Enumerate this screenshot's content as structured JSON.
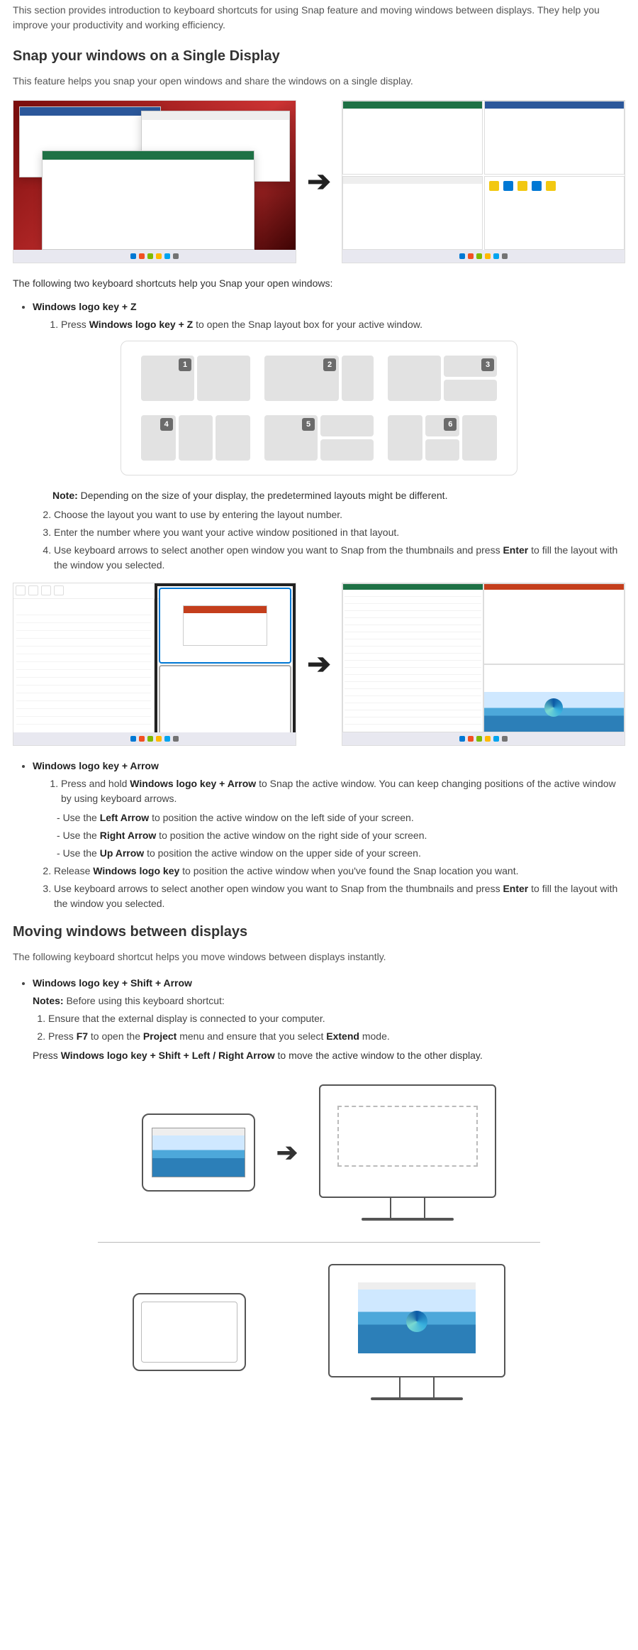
{
  "intro": {
    "p1": "This section provides introduction to keyboard shortcuts for using Snap feature and moving windows between displays. They help you improve your productivity and working efficiency."
  },
  "section1": {
    "heading": "Snap your windows on a Single Display",
    "desc": "This feature helps you snap your open windows and share the windows on a single display.",
    "para_following": "The following two keyboard shortcuts help you Snap your open windows:",
    "shortcut_z_label": "Windows logo key + Z",
    "z_step1_a": "Press ",
    "z_step1_b": "Windows logo key + Z",
    "z_step1_c": " to open the Snap layout box for your active window.",
    "note_label": "Note:",
    "note_text": " Depending on the size of your display, the predetermined layouts might be different.",
    "z_step2": "Choose the layout you want to use by entering the layout number.",
    "z_step3": "Enter the number where you want your active window positioned in that layout.",
    "z_step4": "Use keyboard arrows to select another open window you want to Snap from the thumbnails and press ",
    "z_step4_b": "Enter",
    "z_step4_c": " to fill the layout with the window you selected.",
    "shortcut_arrow_label": "Windows logo key + Arrow",
    "a_step1_a": "Press and hold ",
    "a_step1_b": "Windows logo key + Arrow",
    "a_step1_c": " to Snap the active window. You can keep changing positions of the active window by using keyboard arrows.",
    "a_sub1_a": "Use the ",
    "a_sub1_b": "Left Arrow",
    "a_sub1_c": " to position the active window on the left side of your screen.",
    "a_sub2_a": "Use the ",
    "a_sub2_b": "Right Arrow",
    "a_sub2_c": " to position the active window on the right side of your screen.",
    "a_sub3_a": "Use the ",
    "a_sub3_b": "Up Arrow",
    "a_sub3_c": " to position the active window on the upper side of your screen.",
    "a_step2_a": "Release ",
    "a_step2_b": "Windows logo key",
    "a_step2_c": " to position the active window when you've found the Snap location you want.",
    "a_step3_a": "Use keyboard arrows to select another open window you want to Snap from the thumbnails and press ",
    "a_step3_b": "Enter",
    "a_step3_c": " to fill the layout with the window you selected."
  },
  "section2": {
    "heading": "Moving windows between displays",
    "desc": "The following keyboard shortcut helps you move windows between displays instantly.",
    "shortcut_label": "Windows logo key + Shift + Arrow",
    "notes_label": "Notes:",
    "notes_text": " Before using this keyboard shortcut:",
    "n_step1": "Ensure that the external display is connected to your computer.",
    "n_step2_a": "Press ",
    "n_step2_b": "F7",
    "n_step2_c": " to open the ",
    "n_step2_d": "Project",
    "n_step2_e": " menu and ensure that you select ",
    "n_step2_f": "Extend",
    "n_step2_g": " mode.",
    "press_a": "Press ",
    "press_b": "Windows logo key + Shift + Left / Right Arrow",
    "press_c": " to move the active window to the other display."
  },
  "layout_nums": {
    "n1": "1",
    "n2": "2",
    "n3": "3",
    "n4": "4",
    "n5": "5",
    "n6": "6"
  },
  "arrow_glyph": "➔"
}
